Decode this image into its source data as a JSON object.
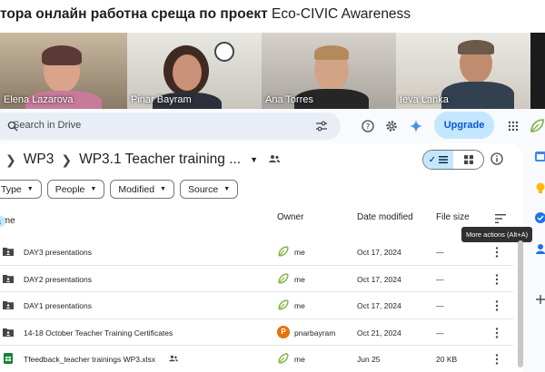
{
  "caption": {
    "bold_text": "тора онлайн работна среща по проект",
    "plain_text": "Eco-CIVIC Awareness"
  },
  "video": {
    "participants": [
      {
        "name": "Elena Lazarova"
      },
      {
        "name": "Pinar Bayram"
      },
      {
        "name": "Ana Torres"
      },
      {
        "name": "Ieva Lanka",
        "active": true
      }
    ]
  },
  "search": {
    "placeholder": "Search in Drive"
  },
  "header": {
    "upgrade_label": "Upgrade"
  },
  "breadcrumb": {
    "items": [
      "WP3",
      "WP3.1 Teacher training ..."
    ]
  },
  "filters": [
    "Type",
    "People",
    "Modified",
    "Source"
  ],
  "table": {
    "columns": {
      "name": "Name",
      "owner": "Owner",
      "modified": "Date modified",
      "size": "File size"
    },
    "tooltip": "More actions (Alt+A)",
    "rows": [
      {
        "name": "DAY3 presentations",
        "type": "folder",
        "owner": "me",
        "modified": "Oct 17, 2024",
        "size": "—"
      },
      {
        "name": "DAY2 presentations",
        "type": "folder",
        "owner": "me",
        "modified": "Oct 17, 2024",
        "size": "—"
      },
      {
        "name": "DAY1 presentations",
        "type": "folder",
        "owner": "me",
        "modified": "Oct 17, 2024",
        "size": "—"
      },
      {
        "name": "14-18 October Teacher Training Certificates",
        "type": "folder",
        "owner": "pnarbayram",
        "owner_initial": "P",
        "modified": "Oct 21, 2024",
        "size": "—"
      },
      {
        "name": "Tfeedback_teacher trainings WP3.xlsx",
        "type": "sheet",
        "owner": "me",
        "modified": "Jun 25",
        "size": "20 KB"
      }
    ]
  },
  "colors": {
    "accent": "#0b57d0",
    "chip_selected": "#c2e7ff",
    "active_speaker": "#3ddc84",
    "owner_avatar": "#e8710a"
  }
}
